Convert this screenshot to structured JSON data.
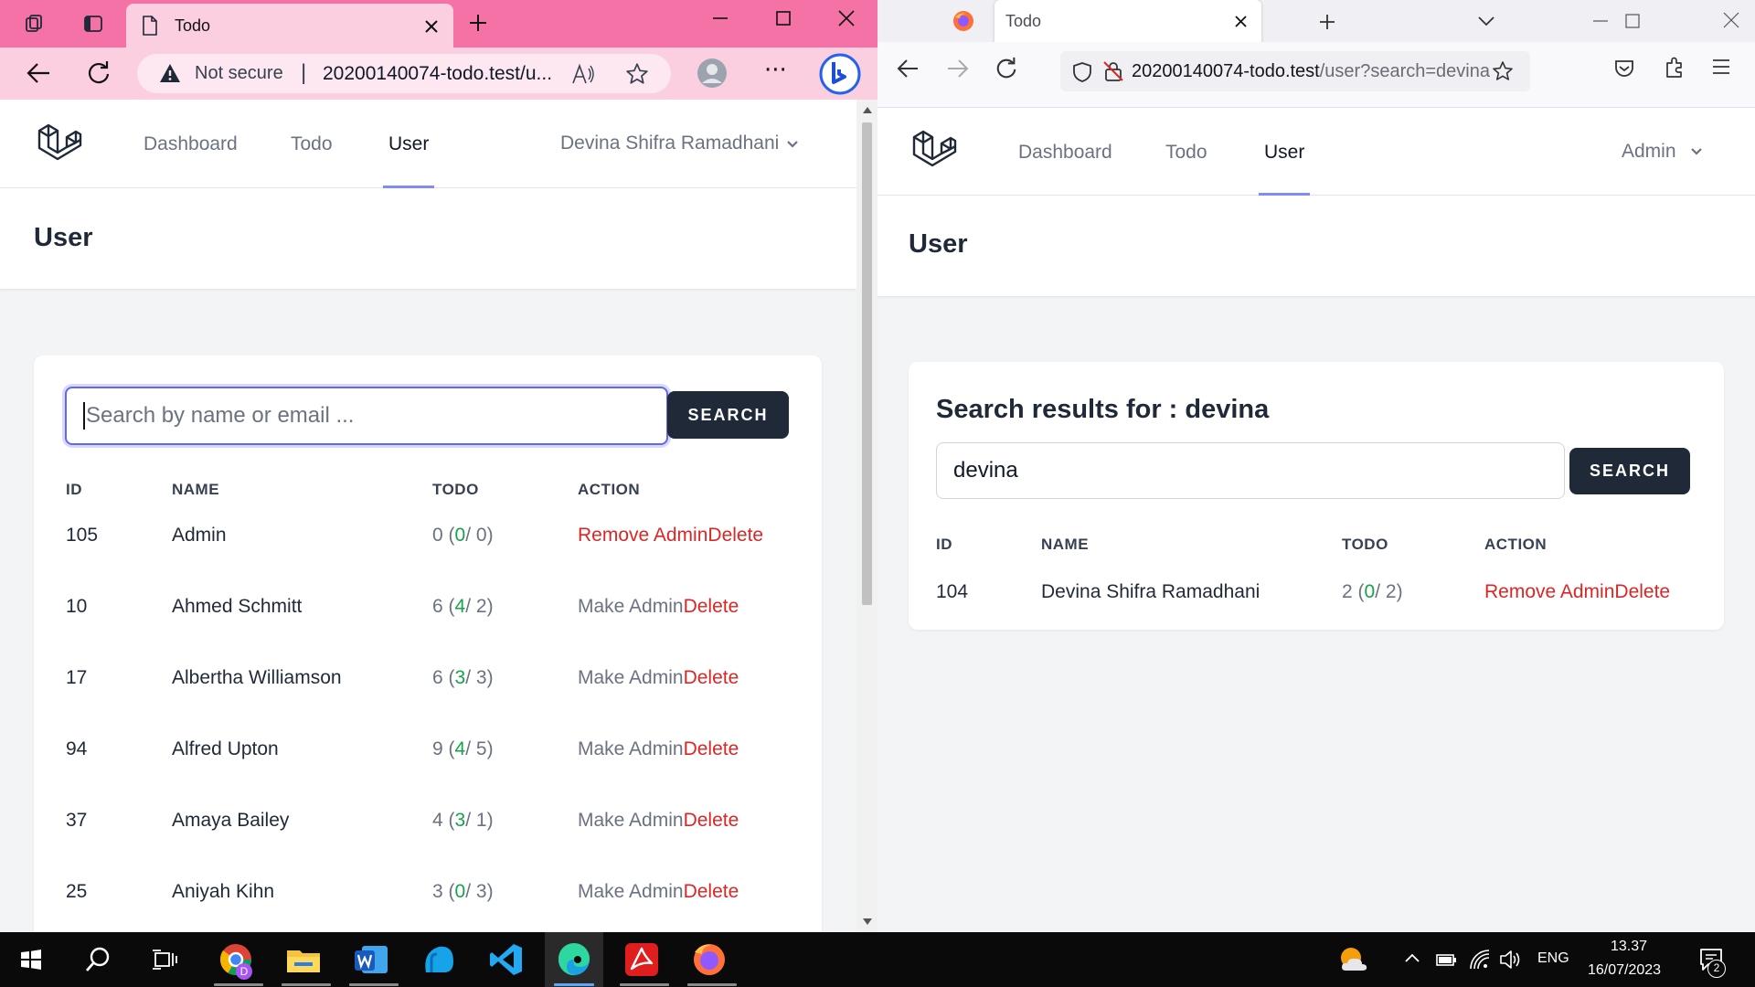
{
  "left_browser": {
    "tab_title": "Todo",
    "security_label": "Not secure",
    "url": "20200140074-todo.test/u...",
    "app": {
      "nav": {
        "dashboard": "Dashboard",
        "todo": "Todo",
        "user": "User",
        "user_menu": "Devina Shifra Ramadhani"
      },
      "page_title": "User",
      "search": {
        "placeholder": "Search by name or email ...",
        "value": "",
        "button": "SEARCH"
      },
      "table": {
        "headers": [
          "ID",
          "NAME",
          "TODO",
          "ACTION"
        ],
        "rows": [
          {
            "id": "105",
            "name": "Admin",
            "todo_total": "0",
            "todo_done": "0",
            "todo_pending": "0",
            "action_primary": "Remove Admin",
            "action_delete": "Delete"
          },
          {
            "id": "10",
            "name": "Ahmed Schmitt",
            "todo_total": "6",
            "todo_done": "4",
            "todo_pending": "2",
            "action_primary": "Make Admin",
            "action_delete": "Delete"
          },
          {
            "id": "17",
            "name": "Albertha Williamson",
            "todo_total": "6",
            "todo_done": "3",
            "todo_pending": "3",
            "action_primary": "Make Admin",
            "action_delete": "Delete"
          },
          {
            "id": "94",
            "name": "Alfred Upton",
            "todo_total": "9",
            "todo_done": "4",
            "todo_pending": "5",
            "action_primary": "Make Admin",
            "action_delete": "Delete"
          },
          {
            "id": "37",
            "name": "Amaya Bailey",
            "todo_total": "4",
            "todo_done": "3",
            "todo_pending": "1",
            "action_primary": "Make Admin",
            "action_delete": "Delete"
          },
          {
            "id": "25",
            "name": "Aniyah Kihn",
            "todo_total": "3",
            "todo_done": "0",
            "todo_pending": "3",
            "action_primary": "Make Admin",
            "action_delete": "Delete"
          }
        ]
      }
    }
  },
  "right_browser": {
    "tab_title": "Todo",
    "url_host": "20200140074-todo.test",
    "url_path": "/user?search=devina",
    "app": {
      "nav": {
        "dashboard": "Dashboard",
        "todo": "Todo",
        "user": "User",
        "user_menu": "Admin"
      },
      "page_title": "User",
      "results_heading": "Search results for : devina",
      "search": {
        "value": "devina",
        "button": "SEARCH"
      },
      "table": {
        "headers": [
          "ID",
          "NAME",
          "TODO",
          "ACTION"
        ],
        "rows": [
          {
            "id": "104",
            "name": "Devina Shifra Ramadhani",
            "todo_total": "2",
            "todo_done": "0",
            "todo_pending": "2",
            "action_primary": "Remove Admin",
            "action_delete": "Delete"
          }
        ]
      }
    }
  },
  "taskbar": {
    "language": "ENG",
    "time": "13.37",
    "date": "16/07/2023",
    "notification_count": "2",
    "chrome_badge": "D"
  },
  "colors": {
    "edge_tabbar": "#f472a6",
    "edge_toolbar": "#fbcfe0",
    "nav_active_underline": "#818cf8",
    "todo_done_green": "#16a34a",
    "action_red": "#dc2626",
    "search_button": "#1f2937"
  },
  "icons": {
    "edge_toolbar": [
      "workspaces-icon",
      "tab-actions-icon",
      "page-icon",
      "close-icon",
      "new-tab-icon",
      "minimize-icon",
      "maximize-icon",
      "window-close-icon",
      "back-icon",
      "refresh-icon",
      "warning-icon",
      "read-aloud-icon",
      "favorite-star-icon",
      "profile-icon",
      "more-icon",
      "bing-icon"
    ],
    "firefox_toolbar": [
      "firefox-icon",
      "close-icon",
      "new-tab-icon",
      "list-tabs-icon",
      "minimize-icon",
      "maximize-icon",
      "window-close-icon",
      "back-icon",
      "forward-icon",
      "refresh-icon",
      "shield-icon",
      "insecure-lock-icon",
      "bookmark-star-icon",
      "pocket-icon",
      "extensions-icon",
      "menu-icon"
    ],
    "taskbar": [
      "windows-start-icon",
      "search-icon",
      "task-view-icon",
      "chrome-icon",
      "file-explorer-icon",
      "word-icon",
      "app-icon",
      "vscode-icon",
      "edge-icon",
      "acrobat-icon",
      "firefox-icon",
      "weather-icon",
      "chevron-up-icon",
      "battery-icon",
      "wifi-icon",
      "volume-icon",
      "notifications-icon"
    ]
  }
}
